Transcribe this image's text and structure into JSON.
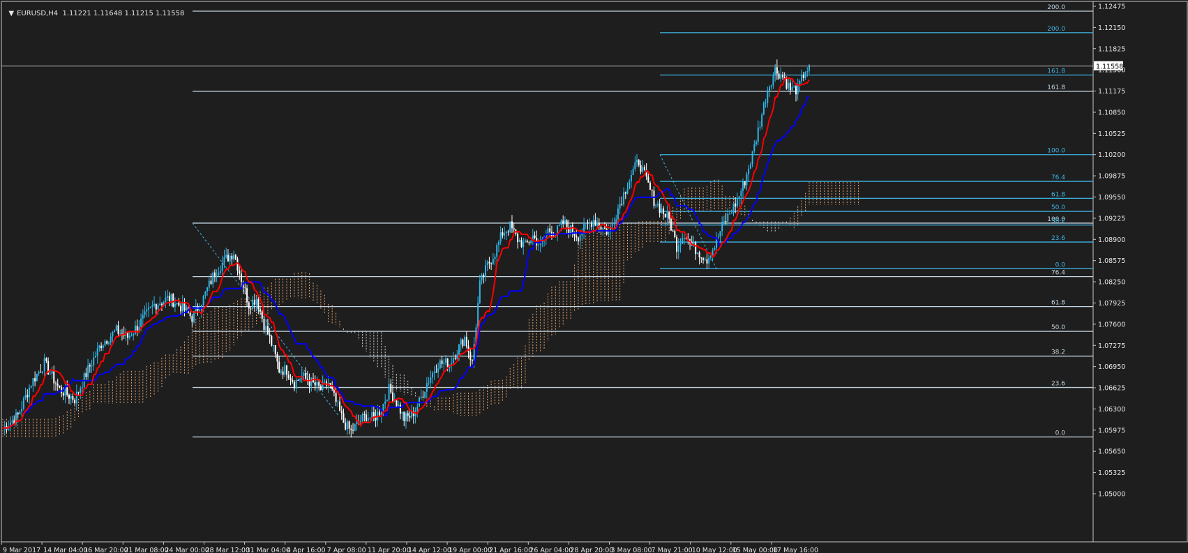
{
  "header": {
    "symbol_tf": "EURUSD,H4",
    "ohlc": "1.11221 1.11648 1.11215 1.11558",
    "collapse_icon": "triangle-down-icon"
  },
  "colors": {
    "background": "#1e1e1e",
    "grid_frame": "#c8c8c8",
    "bull_candle": "#2fb5e6",
    "bear_candle": "#ffffff",
    "tenkan": "#ff0000",
    "kijun": "#0000ff",
    "cloud_up": "#e8a46e",
    "cloud_down": "#d8d8d8",
    "fib_primary": "#c3d4e0",
    "fib_secondary": "#3fb6e6",
    "axis_text": "#e6e6e6"
  },
  "chart_data": {
    "type": "candlestick",
    "symbol": "EURUSD",
    "timeframe": "H4",
    "current_price": "1.11558",
    "ylim": [
      1.05,
      1.12475
    ],
    "y_ticks": [
      "1.12475",
      "1.12150",
      "1.11825",
      "1.11500",
      "1.11175",
      "1.10850",
      "1.10525",
      "1.10200",
      "1.09875",
      "1.09550",
      "1.09225",
      "1.08900",
      "1.08575",
      "1.08250",
      "1.07925",
      "1.07600",
      "1.07275",
      "1.06950",
      "1.06625",
      "1.06300",
      "1.05975",
      "1.05650",
      "1.05325",
      "1.05000"
    ],
    "x_ticks": [
      "9 Mar 2017",
      "14 Mar 04:00",
      "16 Mar 20:00",
      "21 Mar 08:00",
      "24 Mar 00:00",
      "28 Mar 12:00",
      "31 Mar 04:00",
      "4 Apr 16:00",
      "7 Apr 08:00",
      "11 Apr 20:00",
      "14 Apr 12:00",
      "19 Apr 00:00",
      "21 Apr 16:00",
      "26 Apr 04:00",
      "28 Apr 20:00",
      "3 May 08:00",
      "7 May 21:00",
      "10 May 12:00",
      "15 May 00:00",
      "17 May 16:00"
    ],
    "fib_primary": [
      {
        "label": "200.0",
        "price": 1.124
      },
      {
        "label": "161.8",
        "price": 1.1117
      },
      {
        "label": "100.0",
        "price": 1.0915
      },
      {
        "label": "76.4",
        "price": 1.0833
      },
      {
        "label": "61.8",
        "price": 1.0787
      },
      {
        "label": "50.0",
        "price": 1.0749
      },
      {
        "label": "38.2",
        "price": 1.0711
      },
      {
        "label": "23.6",
        "price": 1.0663
      },
      {
        "label": "0.0",
        "price": 1.0587
      }
    ],
    "fib_secondary": [
      {
        "label": "200.0",
        "price": 1.1207
      },
      {
        "label": "161.8",
        "price": 1.1142
      },
      {
        "label": "100.0",
        "price": 1.102
      },
      {
        "label": "76.4",
        "price": 1.0979
      },
      {
        "label": "61.8",
        "price": 1.0953
      },
      {
        "label": "50.0",
        "price": 1.0933
      },
      {
        "label": "38.2",
        "price": 1.0912
      },
      {
        "label": "23.6",
        "price": 1.0886
      },
      {
        "label": "0.0",
        "price": 1.0845
      }
    ],
    "close_path": [
      [
        0,
        1.06
      ],
      [
        8,
        1.062
      ],
      [
        15,
        1.067
      ],
      [
        22,
        1.07
      ],
      [
        30,
        1.066
      ],
      [
        38,
        1.0645
      ],
      [
        45,
        1.069
      ],
      [
        52,
        1.073
      ],
      [
        60,
        1.075
      ],
      [
        66,
        1.074
      ],
      [
        72,
        1.076
      ],
      [
        80,
        1.079
      ],
      [
        88,
        1.08
      ],
      [
        95,
        1.0785
      ],
      [
        100,
        1.077
      ],
      [
        106,
        1.08
      ],
      [
        112,
        1.084
      ],
      [
        118,
        1.086
      ],
      [
        122,
        1.087
      ],
      [
        126,
        1.083
      ],
      [
        130,
        1.079
      ],
      [
        134,
        1.08
      ],
      [
        138,
        1.076
      ],
      [
        142,
        1.073
      ],
      [
        146,
        1.069
      ],
      [
        150,
        1.069
      ],
      [
        154,
        1.067
      ],
      [
        158,
        1.068
      ],
      [
        163,
        1.067
      ],
      [
        168,
        1.066
      ],
      [
        172,
        1.067
      ],
      [
        176,
        1.064
      ],
      [
        180,
        1.061
      ],
      [
        184,
        1.0595
      ],
      [
        188,
        1.061
      ],
      [
        192,
        1.062
      ],
      [
        196,
        1.0615
      ],
      [
        200,
        1.063
      ],
      [
        204,
        1.066
      ],
      [
        208,
        1.064
      ],
      [
        212,
        1.0615
      ],
      [
        216,
        1.062
      ],
      [
        220,
        1.064
      ],
      [
        224,
        1.067
      ],
      [
        230,
        1.07
      ],
      [
        236,
        1.07
      ],
      [
        240,
        1.072
      ],
      [
        244,
        1.074
      ],
      [
        248,
        1.07
      ],
      [
        252,
        1.082
      ],
      [
        256,
        1.085
      ],
      [
        260,
        1.087
      ],
      [
        264,
        1.09
      ],
      [
        268,
        1.091
      ],
      [
        272,
        1.089
      ],
      [
        276,
        1.088
      ],
      [
        280,
        1.0895
      ],
      [
        284,
        1.088
      ],
      [
        288,
        1.0905
      ],
      [
        292,
        1.09
      ],
      [
        296,
        1.0915
      ],
      [
        300,
        1.0905
      ],
      [
        304,
        1.0895
      ],
      [
        308,
        1.091
      ],
      [
        312,
        1.092
      ],
      [
        316,
        1.091
      ],
      [
        320,
        1.09
      ],
      [
        324,
        1.093
      ],
      [
        328,
        1.096
      ],
      [
        332,
        1.099
      ],
      [
        336,
        1.101
      ],
      [
        340,
        1.098
      ],
      [
        344,
        1.095
      ],
      [
        348,
        1.0935
      ],
      [
        352,
        1.092
      ],
      [
        356,
        1.088
      ],
      [
        360,
        1.09
      ],
      [
        364,
        1.088
      ],
      [
        368,
        1.087
      ],
      [
        372,
        1.086
      ],
      [
        376,
        1.088
      ],
      [
        380,
        1.091
      ],
      [
        384,
        1.093
      ],
      [
        388,
        1.095
      ],
      [
        392,
        1.098
      ],
      [
        396,
        1.102
      ],
      [
        400,
        1.107
      ],
      [
        404,
        1.112
      ],
      [
        408,
        1.115
      ],
      [
        412,
        1.114
      ],
      [
        416,
        1.112
      ],
      [
        420,
        1.112
      ],
      [
        424,
        1.115
      ]
    ]
  },
  "labels": {
    "price_tag": "1.11558"
  }
}
